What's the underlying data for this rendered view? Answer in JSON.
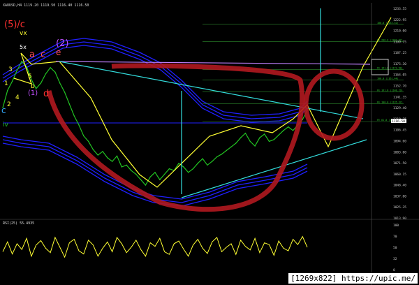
{
  "header": {
    "title": "XAUUSD,H4  1119.20 1119.50 1116.40 1116.50"
  },
  "rsi_header": {
    "title": "RSI(25) 55.4935"
  },
  "watermark": "[1269x822] https://upic.me/",
  "colors": {
    "background": "#000000",
    "price": "#22c322",
    "band": "#2020ff",
    "band_inner": "#3a3aff",
    "trend": "#ffff33",
    "channel": "#33dddd",
    "marker_red": "#b0181f",
    "rsi": "#ffff33",
    "text_axis": "#c8c8c8"
  },
  "chart_data": {
    "type": "line",
    "title": "XAUUSD,H4",
    "y_axis_ticks": [
      "1233.55",
      "1222.95",
      "1210.00",
      "1199.75",
      "1187.25",
      "1175.30",
      "1164.05",
      "1152.70",
      "1141.35",
      "1129.40",
      "1118.25",
      "1106.45",
      "1094.60",
      "1083.00",
      "1071.50",
      "1060.15",
      "1048.40",
      "1037.00",
      "1025.35",
      "1013.90"
    ],
    "current_price": "1116.50",
    "ylim": [
      1010,
      1240
    ],
    "price_series": [
      1131,
      1150,
      1160,
      1172,
      1182,
      1176,
      1162,
      1152,
      1158,
      1168,
      1175,
      1170,
      1158,
      1148,
      1135,
      1122,
      1112,
      1100,
      1094,
      1085,
      1079,
      1083,
      1076,
      1072,
      1078,
      1066,
      1068,
      1062,
      1058,
      1052,
      1046,
      1055,
      1060,
      1052,
      1058,
      1064,
      1062,
      1070,
      1066,
      1060,
      1064,
      1070,
      1075,
      1068,
      1072,
      1077,
      1080,
      1084,
      1088,
      1092,
      1098,
      1103,
      1094,
      1089,
      1098,
      1102,
      1094,
      1096,
      1101,
      1106,
      1110,
      1106,
      1112,
      1118,
      1128
    ],
    "fibonacci_levels": [
      {
        "label": "100.0 (1233.52)",
        "value": 1222.5
      },
      {
        "label": "FE 200.0 (1203.67)",
        "value": 1203.6
      },
      {
        "label": "FE 161.8 (1172.90)",
        "value": 1172.9
      },
      {
        "label": "100.0 (1161.44)",
        "value": 1161.4
      },
      {
        "label": "FE 161.8 (1148.29)",
        "value": 1148.3
      },
      {
        "label": "FE 100.0 (1135.37)",
        "value": 1135.4
      },
      {
        "label": "FE 61.8 (1115.79)",
        "value": 1115.8
      }
    ],
    "wave_labels": [
      {
        "text": "(5)/c",
        "color": "#ff3030"
      },
      {
        "text": "vx",
        "color": "#ffff33"
      },
      {
        "text": "5x",
        "color": "#ffffff"
      },
      {
        "text": "(2)",
        "color": "#c050ff"
      },
      {
        "text": "a",
        "color": "#ff5050"
      },
      {
        "text": "c",
        "color": "#ff5050"
      },
      {
        "text": "e",
        "color": "#ff5050"
      },
      {
        "text": "3",
        "color": "#ffff33"
      },
      {
        "text": "1",
        "color": "#ffff33"
      },
      {
        "text": "2",
        "color": "#ffff33"
      },
      {
        "text": "4",
        "color": "#ffff33"
      },
      {
        "text": "5",
        "color": "#ffff33"
      },
      {
        "text": "(1)",
        "color": "#c050ff"
      },
      {
        "text": "b",
        "color": "#ffff33"
      },
      {
        "text": "d",
        "color": "#ff3030"
      },
      {
        "text": "iv",
        "color": "#22c322"
      },
      {
        "text": "c",
        "color": "#33aaff"
      }
    ],
    "rsi": {
      "name": "RSI(25)",
      "value": 55.4935,
      "levels": [
        "100",
        "70",
        "50",
        "32",
        "0"
      ],
      "values": [
        40,
        62,
        35,
        58,
        45,
        70,
        30,
        55,
        65,
        48,
        38,
        72,
        50,
        28,
        60,
        68,
        42,
        35,
        66,
        55,
        30,
        48,
        62,
        40,
        72,
        58,
        38,
        50,
        66,
        45,
        30,
        60,
        52,
        70,
        40,
        34,
        58,
        64,
        46,
        30,
        55,
        68,
        48,
        36,
        62,
        72,
        40,
        50,
        58,
        34,
        66,
        52,
        44,
        70,
        38,
        60,
        56,
        32,
        64,
        48,
        42,
        68,
        56,
        74,
        50
      ]
    },
    "annotation_box": {
      "label": "1187.25"
    }
  }
}
